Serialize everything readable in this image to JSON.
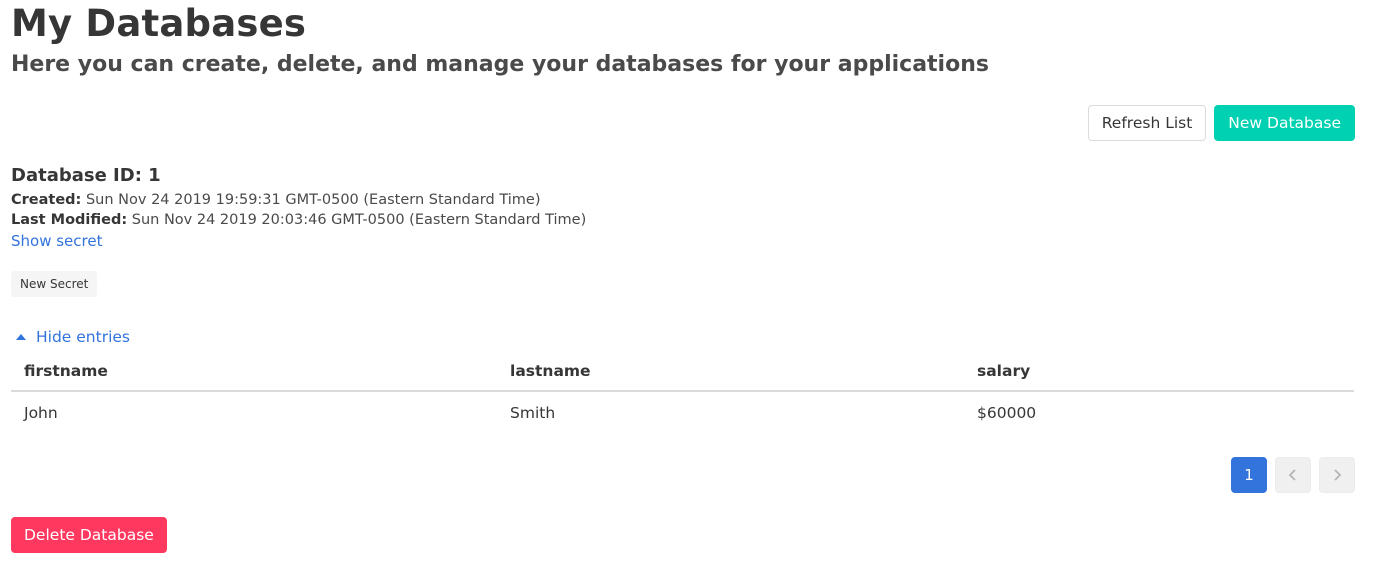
{
  "header": {
    "title": "My Databases",
    "subtitle": "Here you can create, delete, and manage your databases for your applications"
  },
  "toolbar": {
    "refresh_label": "Refresh List",
    "new_database_label": "New Database"
  },
  "database": {
    "heading": "Database ID: 1",
    "created_label": "Created:",
    "created_value": "Sun Nov 24 2019 19:59:31 GMT-0500 (Eastern Standard Time)",
    "modified_label": "Last Modified:",
    "modified_value": "Sun Nov 24 2019 20:03:46 GMT-0500 (Eastern Standard Time)",
    "show_secret_label": "Show secret",
    "new_secret_label": "New Secret",
    "toggle_entries_label": "Hide entries",
    "delete_label": "Delete Database"
  },
  "table": {
    "columns": [
      "firstname",
      "lastname",
      "salary"
    ],
    "rows": [
      [
        "John",
        "Smith",
        "$60000"
      ]
    ]
  },
  "pagination": {
    "current_page": "1",
    "prev_icon": "chevron-left-icon",
    "next_icon": "chevron-right-icon"
  },
  "colors": {
    "primary": "#00d1b2",
    "link": "#3273dc",
    "danger": "#ff3860"
  }
}
